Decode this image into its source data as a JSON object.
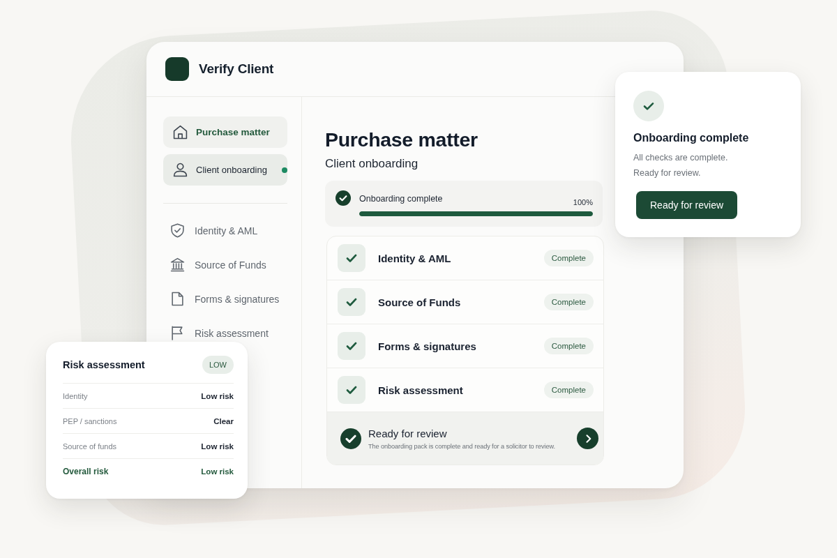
{
  "app": {
    "title": "Verify Client"
  },
  "sidebar": {
    "items": [
      {
        "label": "Purchase matter",
        "kind": "primary",
        "selected": false,
        "dot": false
      },
      {
        "label": "Client onboarding",
        "kind": "primary",
        "selected": true,
        "dot": true
      },
      {
        "label": "Identity & AML",
        "kind": "step",
        "selected": false,
        "dot": false
      },
      {
        "label": "Source of Funds",
        "kind": "step",
        "selected": false,
        "dot": false
      },
      {
        "label": "Forms & signatures",
        "kind": "step",
        "selected": false,
        "dot": false
      },
      {
        "label": "Risk assessment",
        "kind": "step",
        "selected": false,
        "dot": false
      }
    ]
  },
  "main": {
    "title": "Purchase matter",
    "subtitle": "Client onboarding"
  },
  "progress": {
    "label": "Onboarding complete",
    "reading": "100%",
    "level": 1,
    "complete": true
  },
  "checklist": [
    {
      "label": "Identity & AML",
      "status": "Complete",
      "checked": true
    },
    {
      "label": "Source of Funds",
      "status": "Complete",
      "checked": true
    },
    {
      "label": "Forms & signatures",
      "status": "Complete",
      "checked": true
    },
    {
      "label": "Risk assessment",
      "status": "Complete",
      "checked": true
    }
  ],
  "review_banner": {
    "title": "Ready for review",
    "text": "The onboarding pack is complete and ready for a solicitor to review."
  },
  "completion_card": {
    "title": "Onboarding complete",
    "lines": [
      "All checks are complete.",
      "Ready for review."
    ],
    "button": "Ready for review"
  },
  "risk_card": {
    "title": "Risk assessment",
    "badge": "LOW",
    "rows": [
      {
        "label": "Identity",
        "value": "Low risk",
        "kind": "item"
      },
      {
        "label": "PEP / sanctions",
        "value": "Clear",
        "kind": "item"
      },
      {
        "label": "Source of funds",
        "value": "Low risk",
        "kind": "item"
      },
      {
        "label": "Overall risk",
        "value": "Low risk",
        "kind": "summary"
      }
    ]
  }
}
